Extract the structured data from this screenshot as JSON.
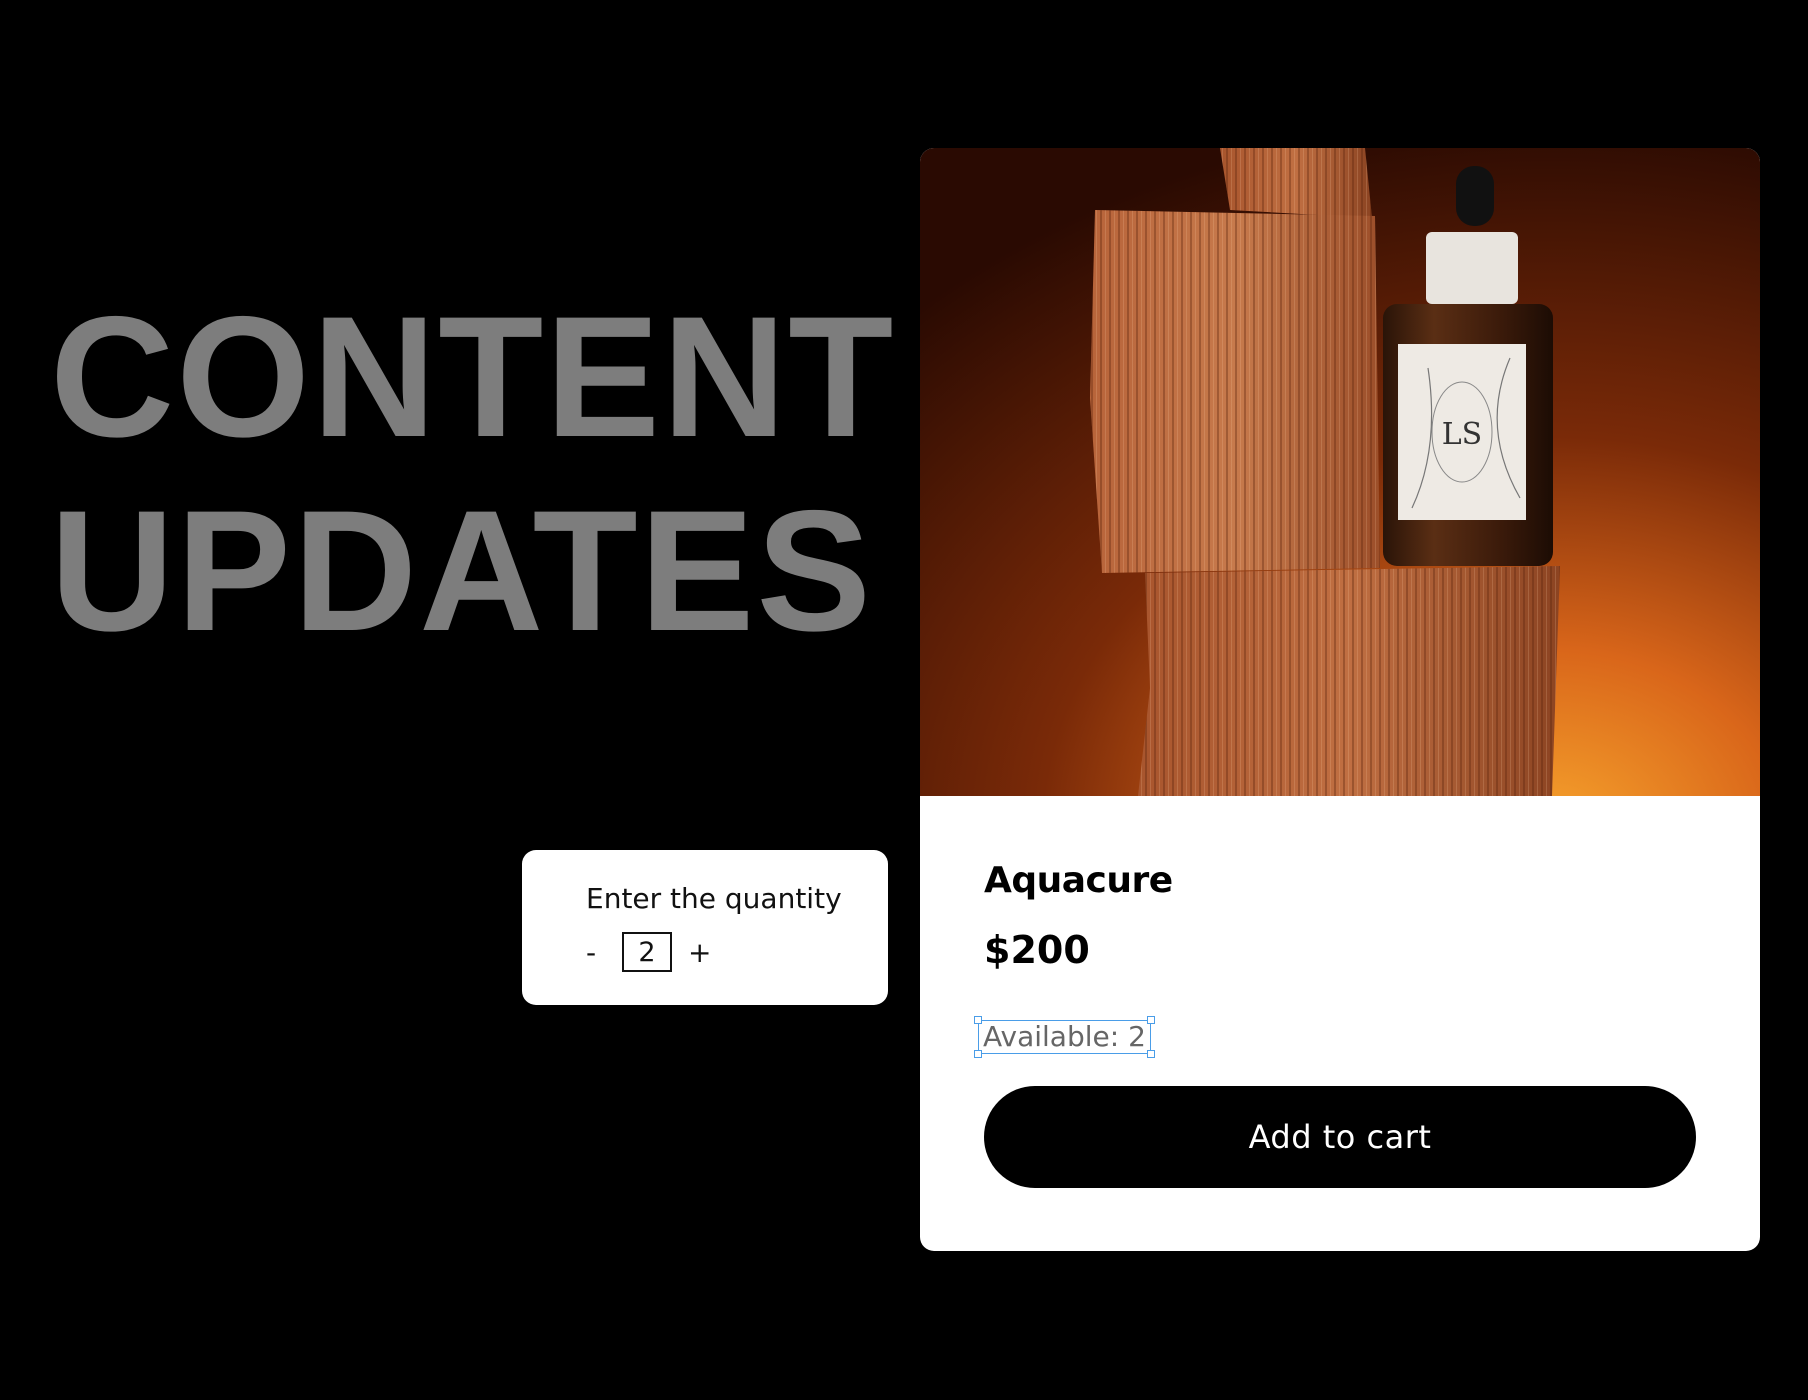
{
  "headline": {
    "line1": "CONTENT",
    "line2": "UPDATES"
  },
  "quantity_widget": {
    "label": "Enter the quantity",
    "decrement_label": "-",
    "value": "2",
    "increment_label": "+"
  },
  "product": {
    "name": "Aquacure",
    "price": "$200",
    "availability": "Available: 2",
    "add_to_cart_label": "Add to cart",
    "bottle_label_monogram": "LS",
    "colors": {
      "accent_orange": "#e07a2a",
      "selection_blue": "#4a9de8"
    }
  }
}
